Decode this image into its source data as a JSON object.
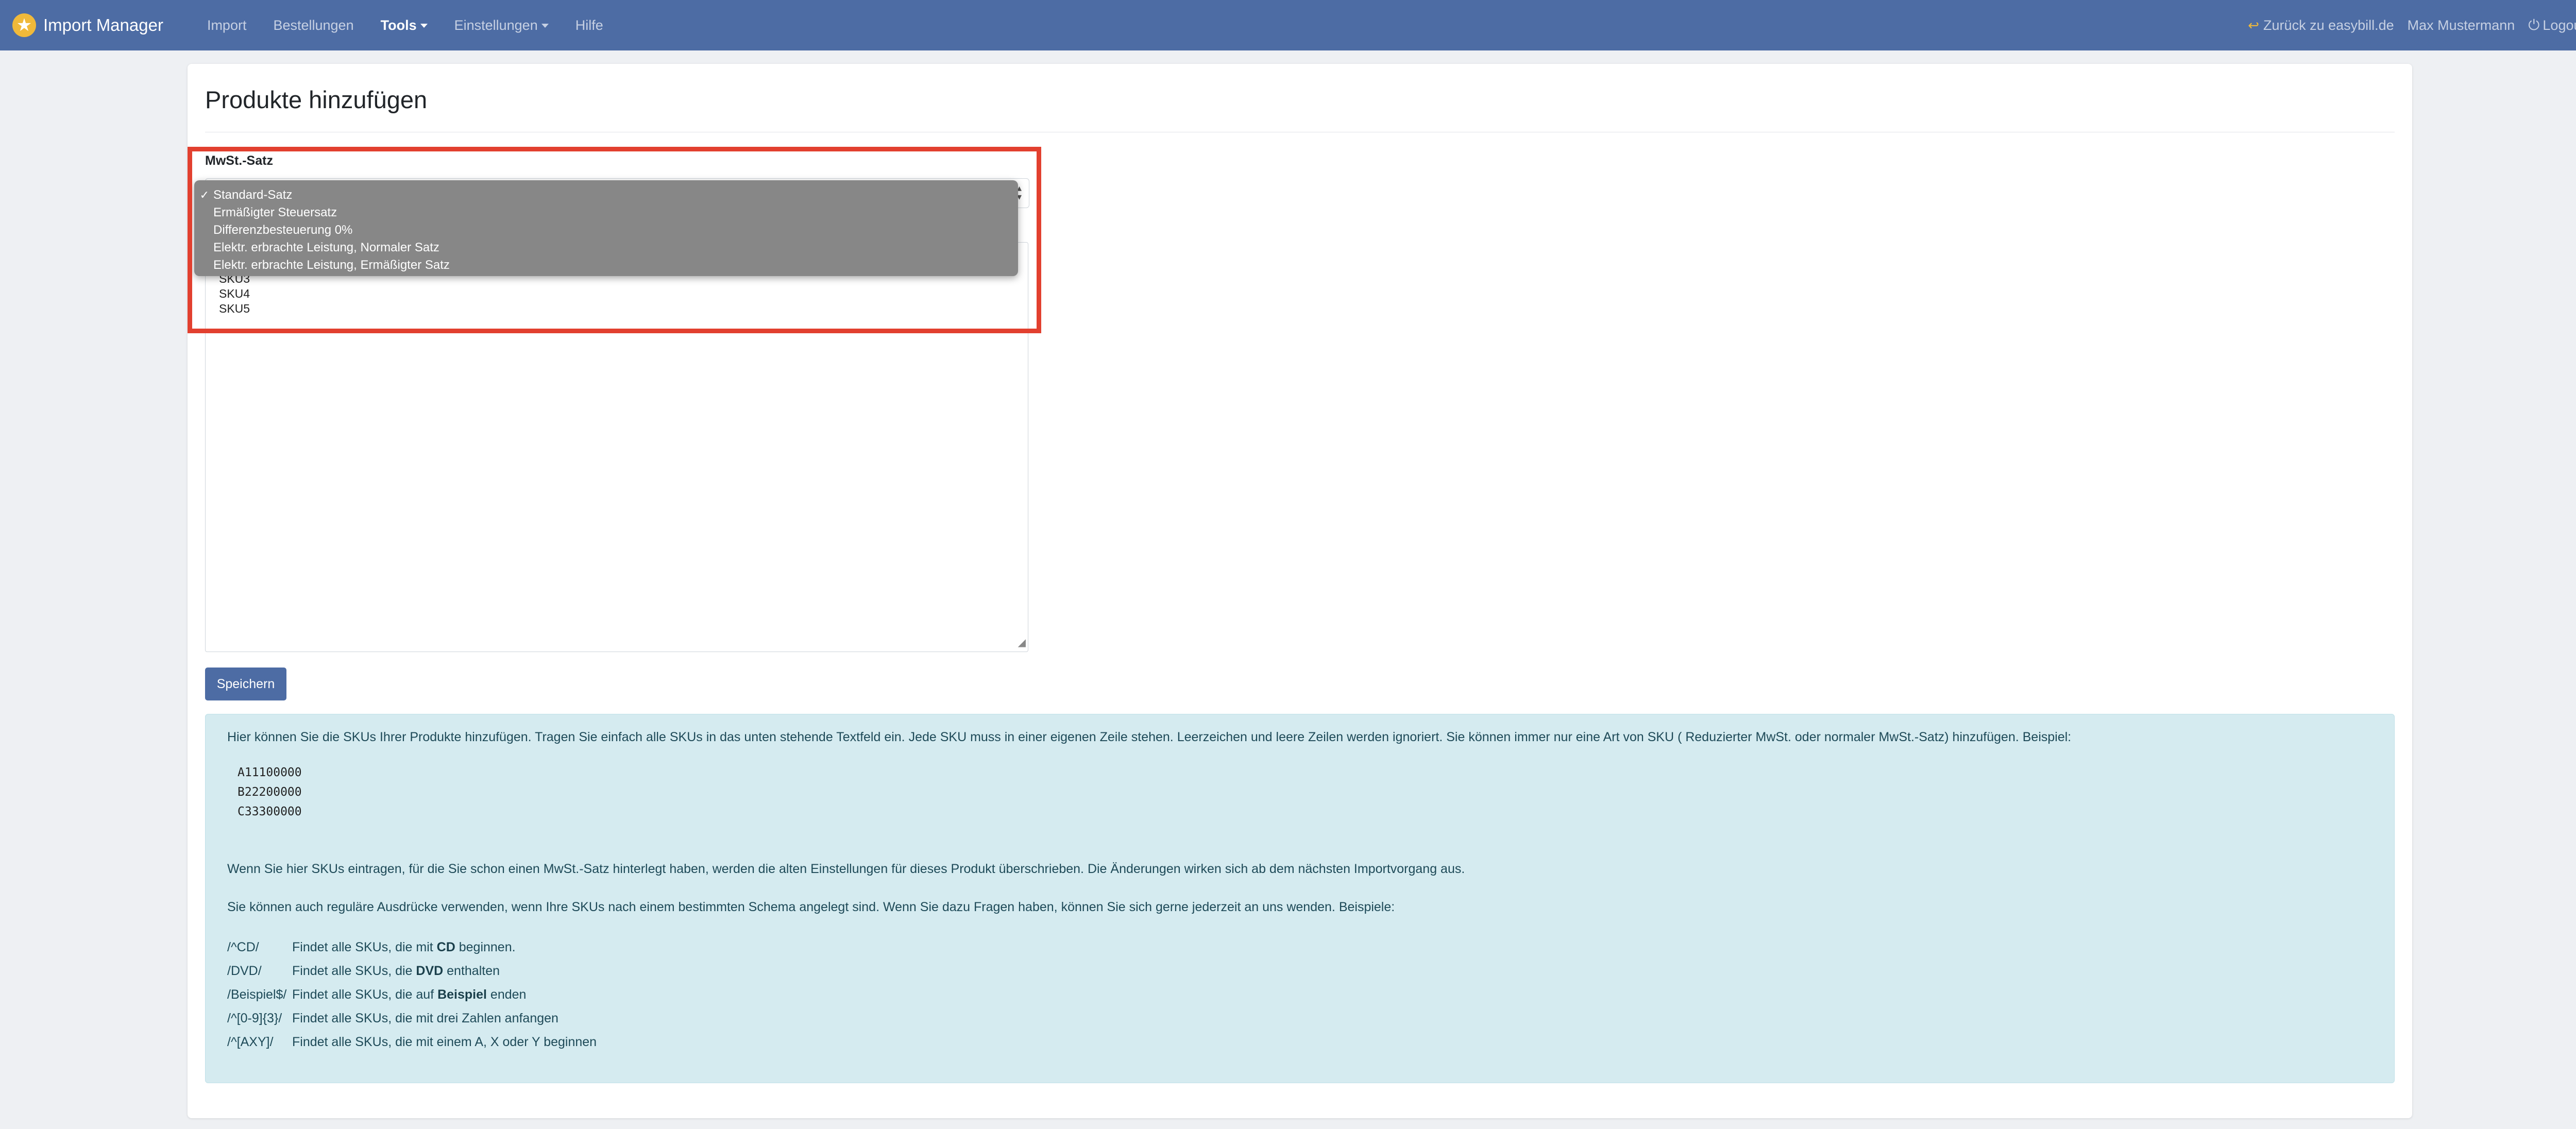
{
  "app": {
    "name": "Import Manager",
    "logo_icon": "star-icon",
    "logo_color": "#f0b93a",
    "navbar_color": "#4d6ca4"
  },
  "nav": {
    "items": [
      {
        "label": "Import",
        "active": false
      },
      {
        "label": "Bestellungen",
        "active": false
      },
      {
        "label": "Tools",
        "active": true,
        "dropdown": true
      },
      {
        "label": "Einstellungen",
        "active": false,
        "dropdown": true
      },
      {
        "label": "Hilfe",
        "active": false
      }
    ],
    "back_link": "Zurück zu easybill.de",
    "user": "Max Mustermann",
    "logout": "Logout"
  },
  "page": {
    "title": "Produkte hinzufügen",
    "vat_label": "MwSt.-Satz",
    "vat_selected": "Standard-Satz",
    "vat_options": [
      "Standard-Satz",
      "Ermäßigter Steuersatz",
      "Differenzbesteuerung 0%",
      "Elektr. erbrachte Leistung, Normaler Satz",
      "Elektr. erbrachte Leistung, Ermäßigter Satz"
    ],
    "sku_lines": [
      "SKU3",
      "SKU4",
      "SKU5"
    ],
    "save_label": "Speichern"
  },
  "info": {
    "intro": "Hier können Sie die SKUs Ihrer Produkte hinzufügen. Tragen Sie einfach alle SKUs in das unten stehende Textfeld ein. Jede SKU muss in einer eigenen Zeile stehen. Leerzeichen und leere Zeilen werden ignoriert. Sie können immer nur eine Art von SKU ( Reduzierter MwSt. oder normaler MwSt.-Satz) hinzufügen. Beispiel:",
    "examples": [
      "A11100000",
      "B22200000",
      "C33300000"
    ],
    "overwrite": "Wenn Sie hier SKUs eintragen, für die Sie schon einen MwSt.-Satz hinterlegt haben, werden die alten Einstellungen für dieses Produkt überschrieben. Die Änderungen wirken sich ab dem nächsten Importvorgang aus.",
    "regex_intro": "Sie können auch reguläre Ausdrücke verwenden, wenn Ihre SKUs nach einem bestimmten Schema angelegt sind. Wenn Sie dazu Fragen haben, können Sie sich gerne jederzeit an uns wenden. Beispiele:",
    "regex": [
      {
        "pattern": "/^CD/",
        "pre": "Findet alle SKUs, die mit ",
        "bold": "CD",
        "post": " beginnen."
      },
      {
        "pattern": "/DVD/",
        "pre": "Findet alle SKUs, die ",
        "bold": "DVD",
        "post": " enthalten"
      },
      {
        "pattern": "/Beispiel$/",
        "pre": "Findet alle SKUs, die auf ",
        "bold": "Beispiel",
        "post": " enden"
      },
      {
        "pattern": "/^[0-9]{3}/",
        "pre": "Findet alle SKUs, die mit drei Zahlen anfangen",
        "bold": "",
        "post": ""
      },
      {
        "pattern": "/^[AXY]/",
        "pre": "Findet alle SKUs, die mit einem A, X oder Y beginnen",
        "bold": "",
        "post": ""
      }
    ]
  }
}
